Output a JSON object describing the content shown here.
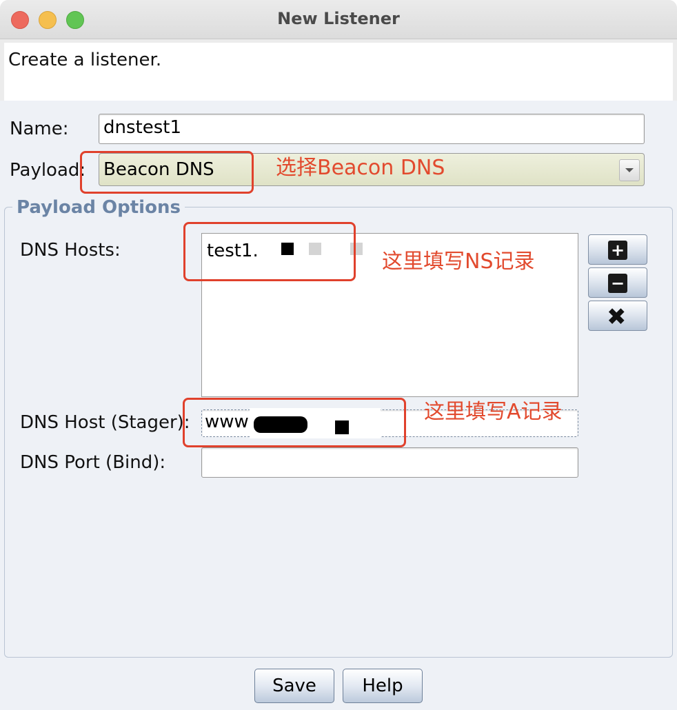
{
  "window": {
    "title": "New Listener",
    "description": "Create a listener."
  },
  "form": {
    "name_label": "Name:",
    "name_value": "dnstest1",
    "payload_label": "Payload:",
    "payload_value": "Beacon DNS"
  },
  "payload_options": {
    "title": "Payload Options",
    "dns_hosts_label": "DNS Hosts:",
    "dns_hosts": [
      "test1."
    ],
    "dns_host_stager_label": "DNS Host (Stager):",
    "dns_host_stager_value": "www",
    "dns_port_label": "DNS Port (Bind):",
    "dns_port_value": ""
  },
  "side_buttons": [
    {
      "icon": "plus-icon"
    },
    {
      "icon": "minus-icon"
    },
    {
      "icon": "x-icon"
    }
  ],
  "annotations": {
    "payload_note": "选择Beacon DNS",
    "dns_hosts_note": "这里填写NS记录",
    "stager_note": "这里填写A记录",
    "color": "#e24a2e"
  },
  "buttons": {
    "save": "Save",
    "help": "Help"
  }
}
